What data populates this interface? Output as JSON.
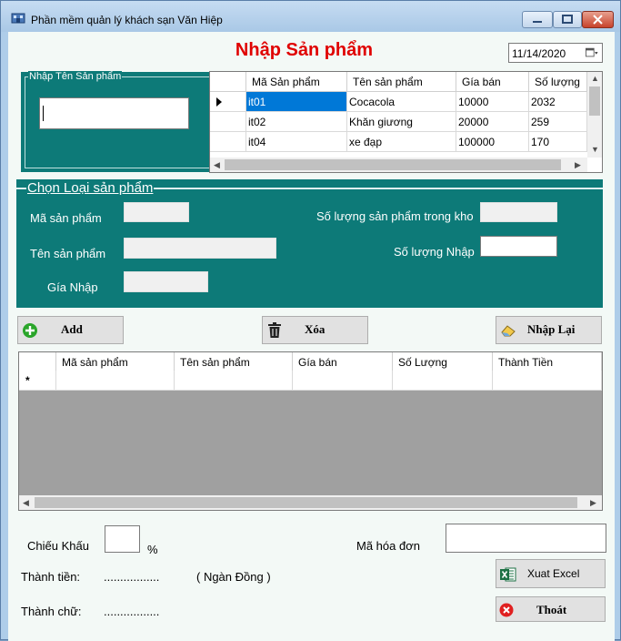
{
  "window": {
    "title": "Phần mềm quản lý khách sạn Văn Hiệp"
  },
  "heading": "Nhập Sản phẩm",
  "date": "11/14/2020",
  "search_group": {
    "label": "Nhập Tên Sản phẩm",
    "value": ""
  },
  "product_grid": {
    "headers": [
      "Mã Sản phẩm",
      "Tên sản phẩm",
      "Gía bán",
      "Số lượng"
    ],
    "rows": [
      [
        "it01",
        "Cocacola",
        "10000",
        "2032"
      ],
      [
        "it02",
        "Khăn giương",
        "20000",
        "259"
      ],
      [
        "it04",
        "xe đạp",
        "100000",
        "170"
      ]
    ]
  },
  "category_group": {
    "label": "Chọn Loại sản phẩm",
    "fields": {
      "ma_sp": "Mã sản phẩm",
      "ten_sp": "Tên sản phẩm",
      "gia_nhap": "Gía Nhập",
      "so_luong_kho": "Số lượng sản phẩm trong kho",
      "so_luong_nhap": "Số lượng Nhập"
    }
  },
  "buttons": {
    "add": "Add",
    "delete": "Xóa",
    "reset": "Nhập Lại",
    "export": "Xuat Excel",
    "exit": "Thoát"
  },
  "order_grid": {
    "headers": [
      "Mã sản phẩm",
      "Tên sản phẩm",
      "Gía bán",
      "Số Lượng",
      "Thành Tiền"
    ],
    "new_row_marker": "*"
  },
  "footer": {
    "discount_label": "Chiếu Khấu",
    "percent": "%",
    "invoice_label": "Mã hóa đơn",
    "total_label": "Thành tiền:",
    "total_value": ".................",
    "currency": "( Ngàn Đồng )",
    "words_label": "Thành chữ:",
    "words_value": "................."
  },
  "colors": {
    "panel": "#0d7a78",
    "heading": "#e00000",
    "selection": "#0078d7"
  }
}
